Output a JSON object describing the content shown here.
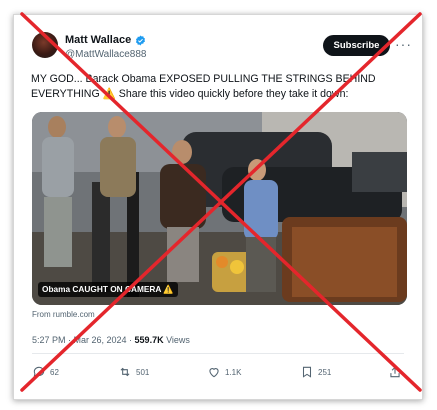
{
  "tweet": {
    "author_name": "Matt Wallace",
    "handle": "@MattWallace888",
    "subscribe_label": "Subscribe",
    "more_label": "···",
    "text": "MY GOD... Barack Obama EXPOSED PULLING THE STRINGS BEHIND EVERYTHING ⚠️ Share this video quickly before they take it down:",
    "media_caption": "Obama CAUGHT ON CAMERA ⚠️",
    "source": "From rumble.com",
    "time": "5:27 PM · Mar 26, 2024 · ",
    "views_count": "559.7K",
    "views_label": " Views"
  },
  "actions": {
    "replies": "62",
    "reposts": "501",
    "likes": "1.1K",
    "bookmarks": "251"
  },
  "colors": {
    "cross": "#e4262c",
    "verified": "#1d9bf0",
    "subscribe_bg": "#0f1419"
  },
  "icons": [
    "verified-badge-icon",
    "more-icon",
    "reply-icon",
    "repost-icon",
    "like-icon",
    "bookmark-icon",
    "share-icon"
  ]
}
